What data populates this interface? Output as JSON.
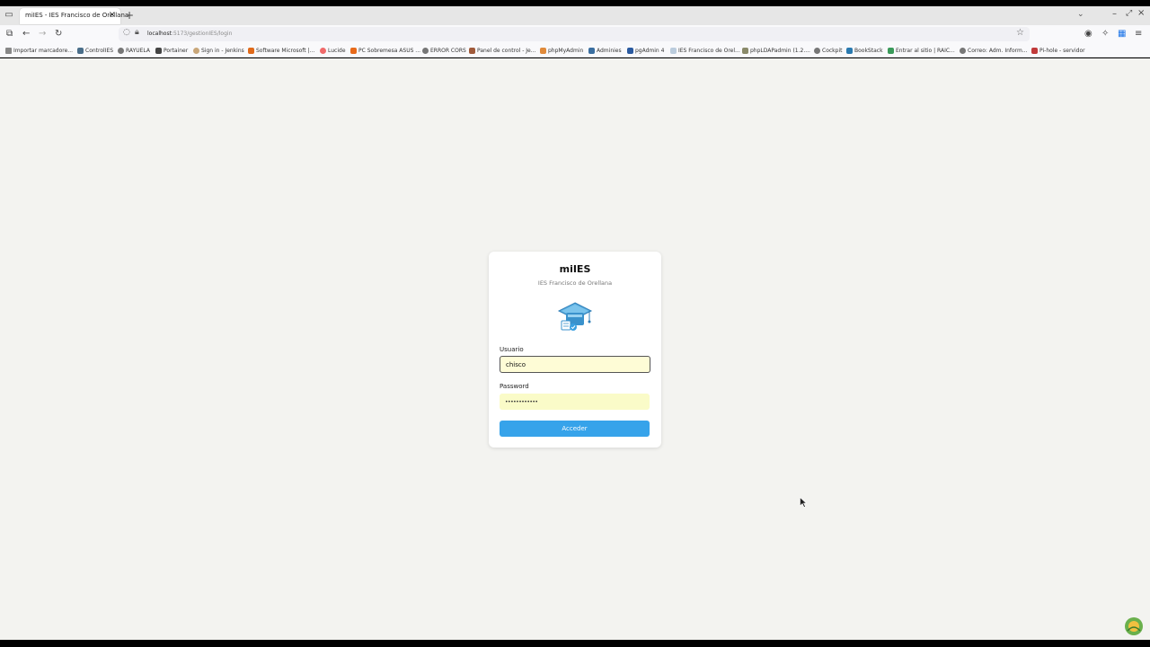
{
  "browser": {
    "tab": {
      "title": "miIES - IES Francisco de Orellana"
    },
    "url": {
      "host": "localhost",
      "path": ":5173/gestionIES/login"
    },
    "bookmarks": [
      "Importar marcadore...",
      "ControlIES",
      "RAYUELA",
      "Portainer",
      "Sign in - Jenkins",
      "Software Microsoft |...",
      "Lucide",
      "PC Sobremesa ASUS ...",
      "ERROR CORS",
      "Panel de control - Je...",
      "phpMyAdmin",
      "Adminies",
      "pgAdmin 4",
      "IES Francisco de Orel...",
      "phpLDAPadmin (1.2....",
      "Cockpit",
      "BookStack",
      "Entrar al sitio | RAIC...",
      "Correo: Adm. Inform...",
      "Pi-hole - servidor"
    ]
  },
  "login": {
    "title": "miIES",
    "subtitle": "IES Francisco de Orellana",
    "user_label": "Usuario",
    "user_value": "chisco",
    "password_label": "Password",
    "password_value": "••••••••••••",
    "submit_label": "Acceder"
  }
}
